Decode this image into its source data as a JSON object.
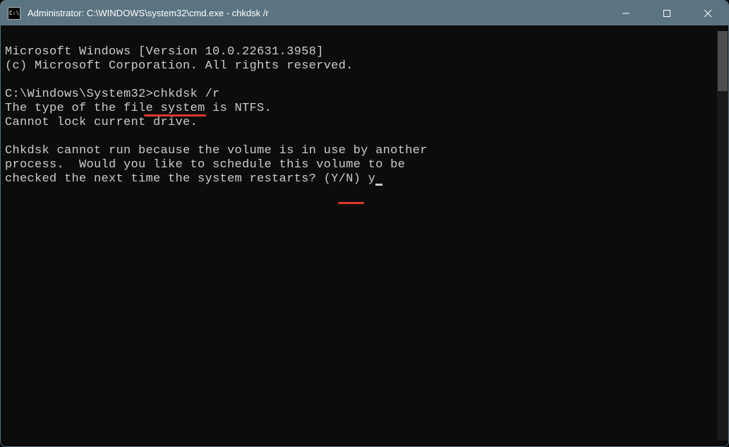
{
  "titlebar": {
    "icon_label": "C:\\",
    "title": "Administrator: C:\\WINDOWS\\system32\\cmd.exe - chkdsk  /r"
  },
  "terminal": {
    "line1": "Microsoft Windows [Version 10.0.22631.3958]",
    "line2": "(c) Microsoft Corporation. All rights reserved.",
    "prompt_path": "C:\\Windows\\System32>",
    "prompt_cmd": "chkdsk /r",
    "out1": "The type of the file system is NTFS.",
    "out2": "Cannot lock current drive.",
    "out3": "Chkdsk cannot run because the volume is in use by another",
    "out4": "process.  Would you like to schedule this volume to be",
    "out5": "checked the next time the system restarts? (Y/N) ",
    "answer": "y"
  }
}
